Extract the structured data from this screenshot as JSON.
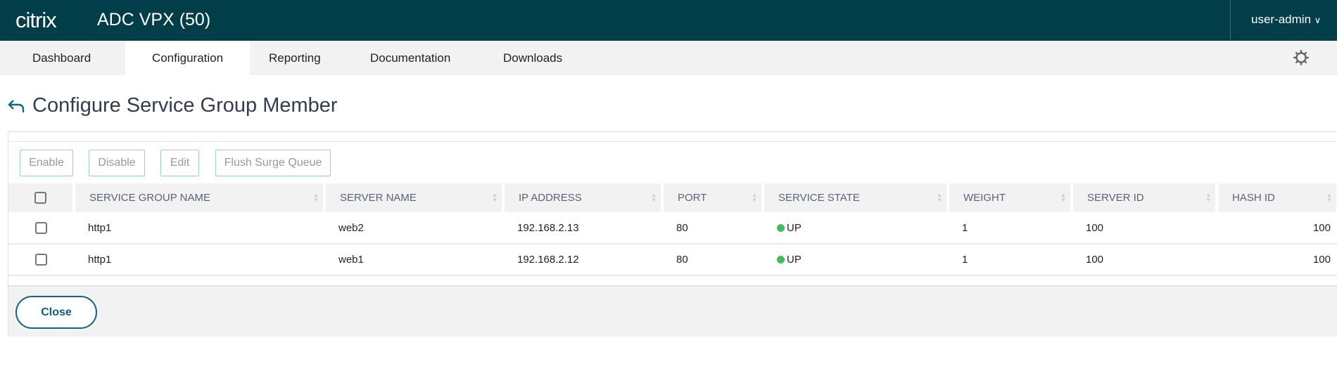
{
  "header": {
    "logo": "citrix",
    "app_title": "ADC VPX (50)",
    "user": "user-admin"
  },
  "nav": {
    "tabs": [
      "Dashboard",
      "Configuration",
      "Reporting",
      "Documentation",
      "Downloads"
    ],
    "active": "Configuration"
  },
  "page": {
    "title": "Configure Service Group Member"
  },
  "toolbar": {
    "enable": "Enable",
    "disable": "Disable",
    "edit": "Edit",
    "flush": "Flush Surge Queue"
  },
  "table": {
    "columns": [
      "SERVICE GROUP NAME",
      "SERVER NAME",
      "IP ADDRESS",
      "PORT",
      "SERVICE STATE",
      "WEIGHT",
      "SERVER ID",
      "HASH ID"
    ],
    "rows": [
      [
        "http1",
        "web2",
        "192.168.2.13",
        "80",
        "UP",
        "1",
        "100",
        "100"
      ],
      [
        "http1",
        "web1",
        "192.168.2.12",
        "80",
        "UP",
        "1",
        "100",
        "100"
      ]
    ]
  },
  "footer": {
    "close": "Close"
  },
  "colors": {
    "header": "#023d4a",
    "accent": "#0b6a80",
    "status_up": "#3fbf5f"
  }
}
